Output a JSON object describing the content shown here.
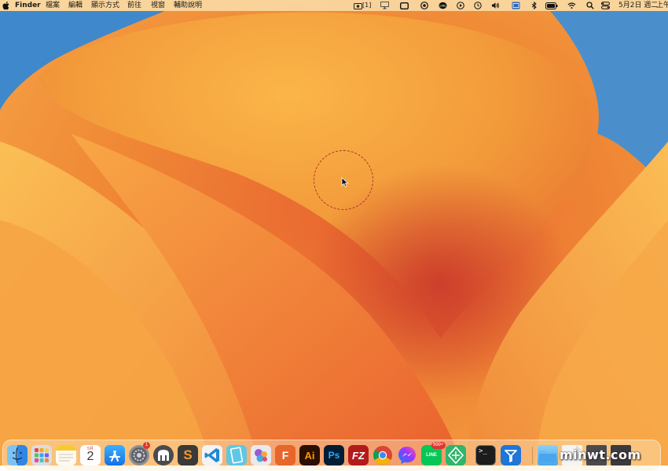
{
  "menubar": {
    "apple_icon": "apple-icon",
    "app_name": "Finder",
    "menus": [
      "檔案",
      "編輯",
      "顯示方式",
      "前往",
      "視窗",
      "輔助說明"
    ],
    "status": {
      "screenshot_count": "[1]",
      "date": "5月2日 週二",
      "time_prefix": "上午"
    }
  },
  "dock": {
    "apps": [
      {
        "name": "Finder",
        "icon": "finder-icon"
      },
      {
        "name": "Launchpad",
        "icon": "launchpad-icon"
      },
      {
        "name": "Notes",
        "icon": "notes-icon"
      },
      {
        "name": "Calendar",
        "icon": "calendar-icon",
        "month": "5月",
        "day": "2"
      },
      {
        "name": "App Store",
        "icon": "app-store-icon"
      },
      {
        "name": "System Settings",
        "icon": "system-settings-icon",
        "badge": "1"
      },
      {
        "name": "Mammoth",
        "icon": "mammoth-icon"
      },
      {
        "name": "Sublime Text",
        "icon": "sublime-text-icon",
        "glyph": "S"
      },
      {
        "name": "Visual Studio Code",
        "icon": "vscode-icon"
      },
      {
        "name": "Notebook",
        "icon": "notebook-icon"
      },
      {
        "name": "Game Center",
        "icon": "game-center-icon"
      },
      {
        "name": "FontLab",
        "icon": "fontlab-icon",
        "glyph": "F"
      },
      {
        "name": "Adobe Illustrator",
        "icon": "illustrator-icon",
        "glyph": "Ai"
      },
      {
        "name": "Adobe Photoshop",
        "icon": "photoshop-icon",
        "glyph": "Ps"
      },
      {
        "name": "FileZilla",
        "icon": "filezilla-icon",
        "glyph": "FZ"
      },
      {
        "name": "Google Chrome",
        "icon": "chrome-icon"
      },
      {
        "name": "Messenger",
        "icon": "messenger-icon"
      },
      {
        "name": "LINE",
        "icon": "line-icon",
        "glyph": "LINE",
        "badge": "999+"
      },
      {
        "name": "Sourcetree",
        "icon": "sourcetree-icon"
      },
      {
        "name": "Terminal",
        "icon": "terminal-icon",
        "glyph": ">_"
      },
      {
        "name": "Mail Tool",
        "icon": "mail-tool-icon"
      }
    ],
    "right": [
      {
        "name": "Applications folder",
        "icon": "folder-icon"
      },
      {
        "name": "Document",
        "icon": "document-icon"
      },
      {
        "name": "Downloads stack",
        "icon": "stack-icon"
      },
      {
        "name": "Trash",
        "icon": "trash-icon"
      }
    ]
  },
  "watermark": "minwt.com",
  "colors": {
    "wallpaper_orange": "#f7a43a",
    "wallpaper_red": "#d4452a",
    "wallpaper_blue": "#3e86c9",
    "cursor_ring": "#b3342c"
  }
}
